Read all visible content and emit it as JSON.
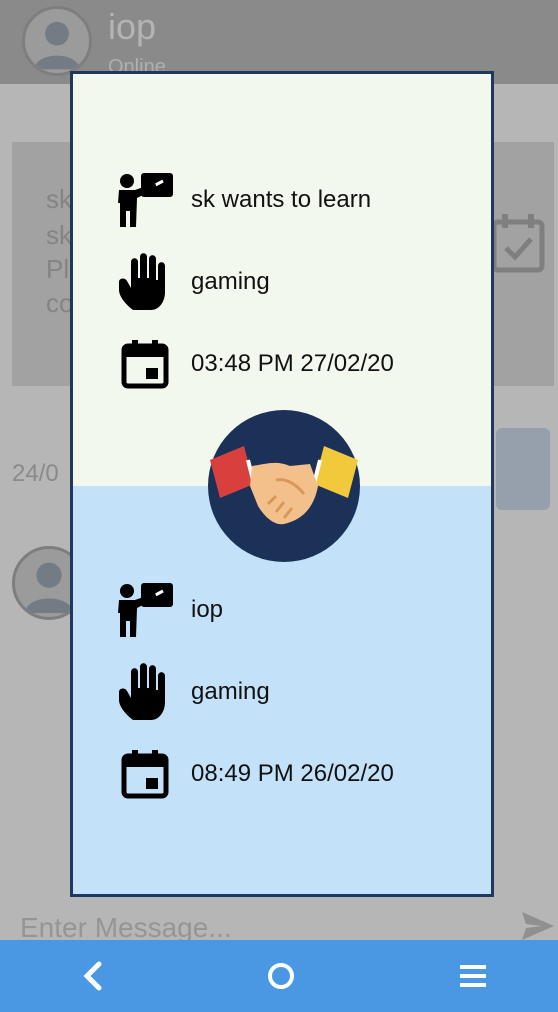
{
  "header": {
    "title": "iop",
    "status": "Online"
  },
  "background_card": {
    "lines": [
      "sk",
      "sk",
      "Pl",
      "co"
    ]
  },
  "background_date": "24/0",
  "input": {
    "placeholder": "Enter Message..."
  },
  "dialog": {
    "top": {
      "teach_text": "sk wants to learn",
      "skill_text": "gaming",
      "time_text": "03:48 PM 27/02/20"
    },
    "bottom": {
      "teach_text": "iop",
      "skill_text": "gaming",
      "time_text": "08:49 PM 26/02/20"
    },
    "colors": {
      "top_bg": "#f2f8ee",
      "bottom_bg": "#c3e1f8",
      "border": "#1f3860"
    }
  },
  "icons": {
    "teach": "teacher-board-icon",
    "skill": "raised-hand-icon",
    "time": "calendar-icon",
    "center": "handshake-icon",
    "nav_back": "back-chevron-icon",
    "nav_home": "home-circle-icon",
    "nav_menu": "menu-lines-icon"
  },
  "navbar": {
    "color": "#4a97e4"
  }
}
